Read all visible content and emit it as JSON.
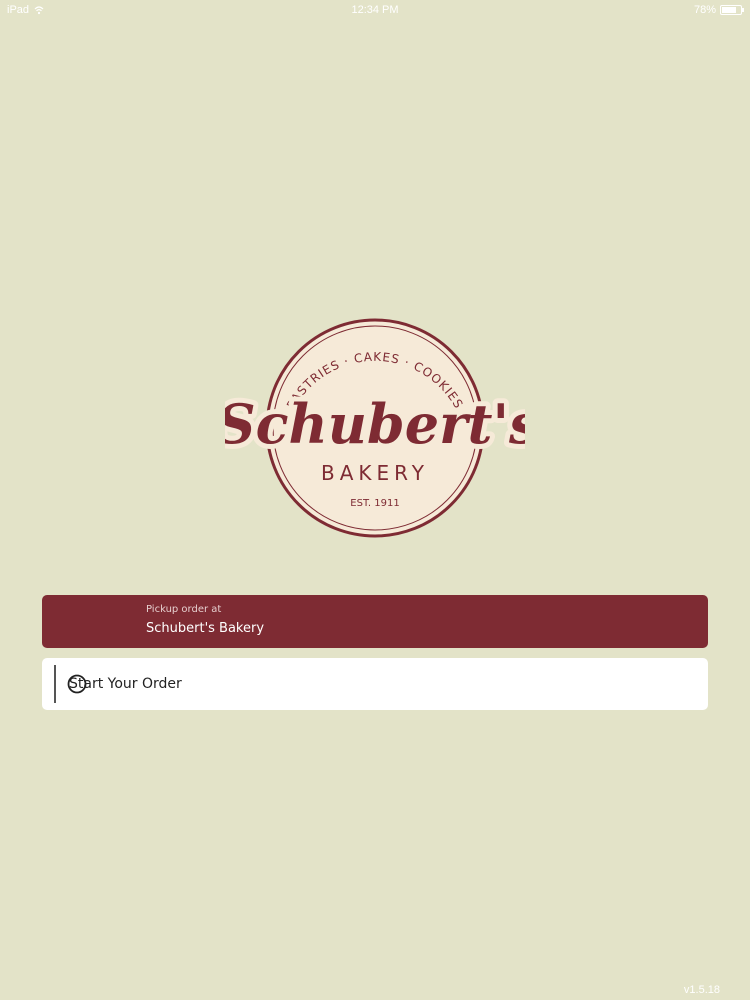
{
  "status_bar": {
    "device": "iPad",
    "time": "12:34 PM",
    "battery": "78%",
    "battery_level": 0.78
  },
  "logo": {
    "arc_text": "PASTRIES · CAKES · COOKIES",
    "script_name": "Schubert's",
    "word": "BAKERY",
    "established": "EST. 1911"
  },
  "pickup": {
    "label": "Pickup order at",
    "store": "Schubert's Bakery"
  },
  "start_order": {
    "label": "Start Your Order"
  },
  "footer": {
    "version": "v1.5.18"
  },
  "colors": {
    "background": "#e3e3c8",
    "brand_red": "#7e2b33",
    "logo_cream": "#f6ead8",
    "white": "#ffffff"
  }
}
